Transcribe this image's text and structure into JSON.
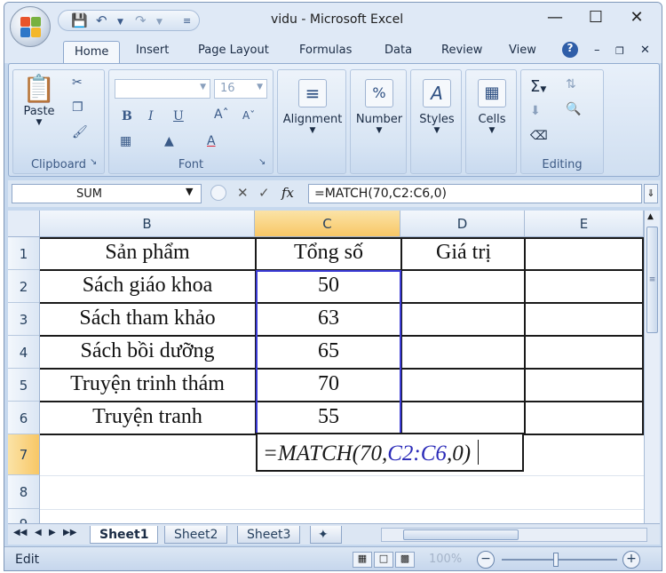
{
  "window": {
    "title": "vidu - Microsoft Excel"
  },
  "tabs": [
    "Home",
    "Insert",
    "Page Layout",
    "Formulas",
    "Data",
    "Review",
    "View"
  ],
  "ribbon": {
    "clipboard": {
      "label": "Clipboard",
      "paste": "Paste"
    },
    "font": {
      "label": "Font",
      "size": "16",
      "bold": "B",
      "italic": "I",
      "underline": "U"
    },
    "alignment": {
      "label": "Alignment"
    },
    "number": {
      "label": "Number",
      "icon_text": "%"
    },
    "styles": {
      "label": "Styles"
    },
    "cells": {
      "label": "Cells"
    },
    "editing": {
      "label": "Editing"
    }
  },
  "formula_bar": {
    "name_box": "SUM",
    "fx": "fx",
    "formula": "=MATCH(70,C2:C6,0)"
  },
  "columns": [
    "B",
    "C",
    "D",
    "E"
  ],
  "rows": [
    "1",
    "2",
    "3",
    "4",
    "5",
    "6",
    "7",
    "8",
    "9"
  ],
  "table": {
    "headers": [
      "Sản phẩm",
      "Tổng số",
      "Giá trị"
    ],
    "rows": [
      {
        "product": "Sách giáo khoa",
        "total": "50"
      },
      {
        "product": "Sách tham khảo",
        "total": "63"
      },
      {
        "product": "Sách bồi dưỡng",
        "total": "65"
      },
      {
        "product": "Truyện trinh thám",
        "total": "70"
      },
      {
        "product": "Truyện tranh",
        "total": "55"
      }
    ]
  },
  "edit_cell": {
    "prefix": "=MATCH(70,",
    "ref": "C2:C6",
    "suffix": ",0)"
  },
  "sheets": [
    "Sheet1",
    "Sheet2",
    "Sheet3"
  ],
  "status": {
    "mode": "Edit",
    "zoom": "100%"
  },
  "colors": {
    "range_highlight": "#3b3bd6",
    "selected_header": "#f8c766",
    "ribbon_bg": "#d0dff1"
  }
}
